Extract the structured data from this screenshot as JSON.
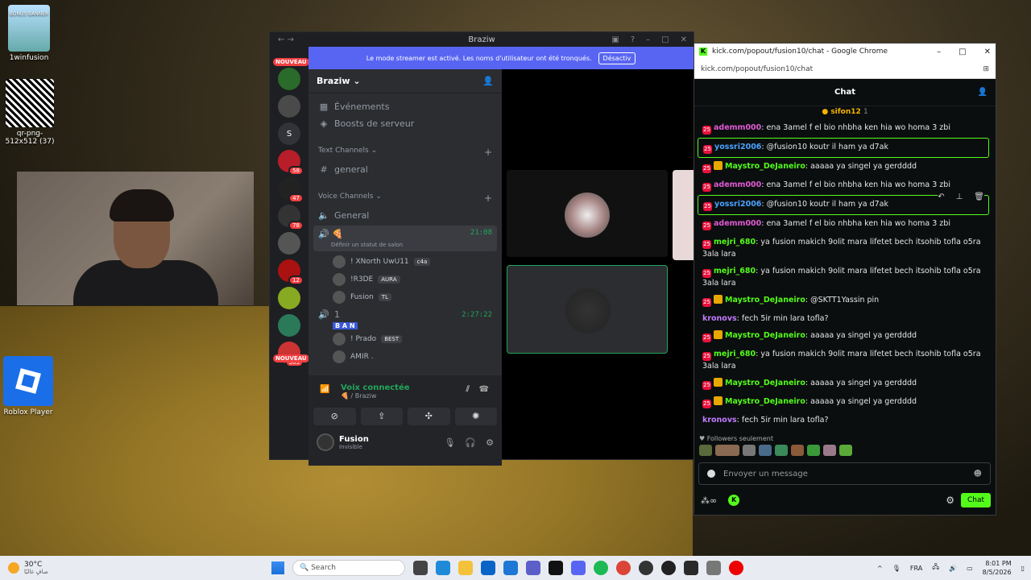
{
  "desktop": {
    "icons": [
      {
        "label": "1winfusion",
        "image_text": "BONUS BANNER"
      },
      {
        "label": "qr-png-512x512 (37)"
      },
      {
        "label": "Roblox Player"
      }
    ]
  },
  "discord": {
    "window_title": "Braziw",
    "banner_text": "Le mode streamer est activé. Les noms d'utilisateur ont été tronqués.",
    "banner_button": "Désactiv",
    "server_rail": [
      {
        "label": "",
        "badge": "",
        "color": "#2a6a2a"
      },
      {
        "label": "",
        "badge": "",
        "color": "#4a4a4a"
      },
      {
        "label": "S",
        "badge": "",
        "color": "#313338"
      },
      {
        "label": "",
        "badge": "58",
        "color": "#b81d2a"
      },
      {
        "label": "",
        "badge": "47",
        "color": "#222"
      },
      {
        "label": "",
        "badge": "78",
        "color": "#333"
      },
      {
        "label": "",
        "badge": "",
        "color": "#555"
      },
      {
        "label": "",
        "badge": "12",
        "color": "#a11"
      },
      {
        "label": "",
        "badge": "",
        "color": "#8a2"
      },
      {
        "label": "",
        "badge": "",
        "color": "#2a7a5a"
      },
      {
        "label": "",
        "badge": "303",
        "color": "#c33"
      }
    ],
    "nouveau": "NOUVEAU",
    "server_name": "Braziw",
    "top_channels": [
      {
        "icon": "calendar-icon",
        "label": "Événements"
      },
      {
        "icon": "boost-icon",
        "label": "Boosts de serveur"
      }
    ],
    "text_category": "Text Channels",
    "text_channels": [
      "general"
    ],
    "voice_category": "Voice Channels",
    "voice_channels_general": "General",
    "active_voice": {
      "name": "🍕",
      "time": "21:08",
      "status": "Définir un statut de salon"
    },
    "voice_users": [
      {
        "name": "! XNorth UwU11",
        "tag": "c4a"
      },
      {
        "name": "!R3DE",
        "tag": "AURA"
      },
      {
        "name": "Fusion",
        "tag": "TL"
      }
    ],
    "second_voice": {
      "name": "1",
      "time": "2:27:22",
      "label_tag": "B A N"
    },
    "second_users": [
      {
        "name": "! Prado",
        "tag": "BEST"
      },
      {
        "name": "AMIR .",
        "tag": ""
      }
    ],
    "voice_connected": "Voix connectée",
    "voice_connected_sub": "🍕 / Braziw",
    "user_name": "Fusion",
    "user_status": "Invisible"
  },
  "chrome": {
    "title": "kick.com/popout/fusion10/chat - Google Chrome",
    "url": "kick.com/popout/fusion10/chat",
    "header": "Chat",
    "pinned_user": "sifon12",
    "pinned_count": "1",
    "messages": [
      {
        "user": "ademm000",
        "color": "#e05ad5",
        "text": "ena 3amel f el bio nhbha ken hia wo homa 3 zbi",
        "crown": false,
        "hl": false
      },
      {
        "user": "yossri2006",
        "color": "#4aa3ff",
        "text": "@fusion10 koutr il ham ya d7ak",
        "crown": false,
        "hl": true
      },
      {
        "user": "Maystro_DeJaneiro",
        "color": "#53fc18",
        "text": "aaaaa ya singel ya gerdddd",
        "crown": true,
        "hl": false
      },
      {
        "user": "ademm000",
        "color": "#e05ad5",
        "text": "ena 3amel f el bio nhbha ken hia wo homa 3 zbi",
        "crown": false,
        "hl": false,
        "actions": true
      },
      {
        "user": "yossri2006",
        "color": "#4aa3ff",
        "text": "@fusion10 koutr il ham ya d7ak",
        "crown": false,
        "hl": true
      },
      {
        "user": "ademm000",
        "color": "#e05ad5",
        "text": "ena 3amel f el bio nhbha ken hia wo homa 3 zbi",
        "crown": false,
        "hl": false
      },
      {
        "user": "mejri_680",
        "color": "#53fc18",
        "text": "ya fusion makich 9olit mara lifetet bech itsohib tofla o5ra 3ala lara",
        "crown": false,
        "hl": false
      },
      {
        "user": "mejri_680",
        "color": "#53fc18",
        "text": "ya fusion makich 9olit mara lifetet bech itsohib tofla o5ra 3ala lara",
        "crown": false,
        "hl": false
      },
      {
        "user": "Maystro_DeJaneiro",
        "color": "#53fc18",
        "text": "@SKTT1Yassin pin",
        "crown": true,
        "hl": false
      },
      {
        "user": "kronovs",
        "color": "#c07bff",
        "text": "fech 5ir min lara tofla?",
        "crown": false,
        "hl": false,
        "nobadge": true
      },
      {
        "user": "Maystro_DeJaneiro",
        "color": "#53fc18",
        "text": "aaaaa ya singel ya gerdddd",
        "crown": true,
        "hl": false
      },
      {
        "user": "mejri_680",
        "color": "#53fc18",
        "text": "ya fusion makich 9olit mara lifetet bech itsohib tofla o5ra 3ala lara",
        "crown": false,
        "hl": false
      },
      {
        "user": "Maystro_DeJaneiro",
        "color": "#53fc18",
        "text": "aaaaa ya singel ya gerdddd",
        "crown": true,
        "hl": false
      },
      {
        "user": "Maystro_DeJaneiro",
        "color": "#53fc18",
        "text": "aaaaa ya singel ya gerdddd",
        "crown": true,
        "hl": false
      },
      {
        "user": "kronovs",
        "color": "#c07bff",
        "text": "fech 5ir min lara tofla?",
        "crown": false,
        "hl": false,
        "nobadge": true
      },
      {
        "user": "Maystro_DeJaneiro",
        "color": "#53fc18",
        "text": "aaaaa ya singel ya gerdddd",
        "crown": true,
        "hl": false
      }
    ],
    "followers_only": "Followers seulement",
    "input_placeholder": "Envoyer un message",
    "chat_button": "Chat"
  },
  "taskbar": {
    "temp": "30°C",
    "weather_desc": "صافٍ غالبًا",
    "search_label": "Search",
    "lang": "FRA",
    "time": "8:01 PM",
    "date": "8/5/2026"
  }
}
